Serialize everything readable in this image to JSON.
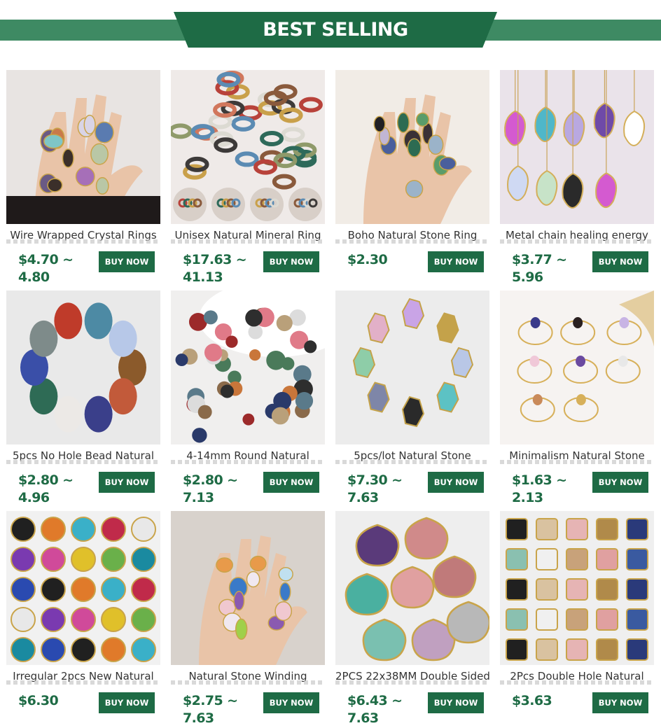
{
  "header": {
    "title": "BEST SELLING"
  },
  "colors": {
    "brand_green": "#1e6b45",
    "band_green": "#3e8a63"
  },
  "products": [
    {
      "title": "Wire Wrapped Crystal Rings",
      "price": "$4.70 ~ 4.80",
      "button": "BUY NOW",
      "image": "crystal-rings-on-hand"
    },
    {
      "title": "Unisex Natural Mineral Ring",
      "price": "$17.63 ~ 41.13",
      "button": "BUY NOW",
      "image": "stone-band-rings-pile"
    },
    {
      "title": "Boho Natural Stone Ring",
      "price": "$2.30",
      "button": "BUY NOW",
      "image": "stone-rings-on-fingers"
    },
    {
      "title": "Metal chain healing energy",
      "price": "$3.77 ~ 5.96",
      "button": "BUY NOW",
      "image": "druzy-pendant-necklaces"
    },
    {
      "title": "5pcs No Hole Bead Natural",
      "price": "$2.80 ~ 4.96",
      "button": "BUY NOW",
      "image": "oval-cabochons-circle"
    },
    {
      "title": "4-14mm Round Natural",
      "price": "$2.80 ~ 7.13",
      "button": "BUY NOW",
      "image": "round-cabochons-plate"
    },
    {
      "title": "5pcs/lot Natural Stone",
      "price": "$7.30 ~ 7.63",
      "button": "BUY NOW",
      "image": "raw-stone-pendants"
    },
    {
      "title": "Minimalism Natural Stone",
      "price": "$1.63 ~ 2.13",
      "button": "BUY NOW",
      "image": "wire-stone-rings"
    },
    {
      "title": "Irregular 2pcs New Natural",
      "price": "$6.30",
      "button": "BUY NOW",
      "image": "druzy-slice-connectors"
    },
    {
      "title": "Natural Stone Winding",
      "price": "$2.75 ~ 7.63",
      "button": "BUY NOW",
      "image": "wire-wrapped-stones-palm"
    },
    {
      "title": "2PCS 22x38MM Double Sided",
      "price": "$6.43 ~ 7.63",
      "button": "BUY NOW",
      "image": "faceted-teardrop-connectors"
    },
    {
      "title": "2Pcs Double Hole Natural",
      "price": "$3.63",
      "button": "BUY NOW",
      "image": "faceted-square-connectors"
    }
  ]
}
